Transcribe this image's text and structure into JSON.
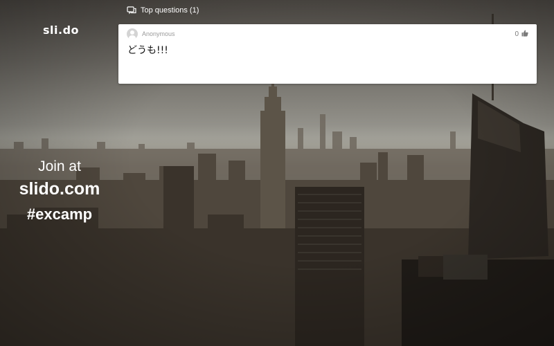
{
  "brand": {
    "logo": "sli.do"
  },
  "join": {
    "line1": "Join at",
    "url": "slido.com",
    "hashtag": "#excamp"
  },
  "panel": {
    "title": "Top questions (1)",
    "icon": "chat-bubbles-icon"
  },
  "questions": [
    {
      "author": "Anonymous",
      "text": "どうも!!!",
      "likes": "0",
      "like_icon": "thumbs-up-icon"
    }
  ],
  "colors": {
    "text": "#ffffff",
    "card": "#ffffff",
    "muted": "#9a9a9a"
  }
}
